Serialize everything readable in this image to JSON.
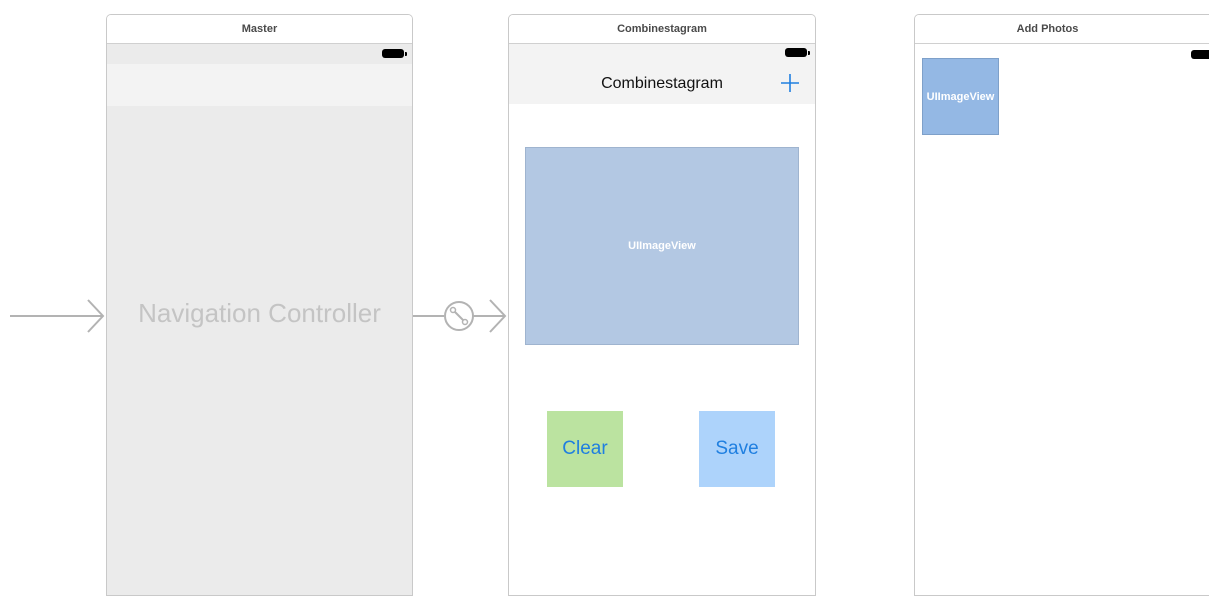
{
  "scenes": {
    "master": {
      "header": "Master",
      "body_label": "Navigation Controller"
    },
    "main": {
      "header": "Combinestagram",
      "nav_title": "Combinestagram",
      "image_view_label": "UIImageView",
      "clear_button": "Clear",
      "save_button": "Save"
    },
    "add_photos": {
      "header": "Add Photos",
      "thumb_label": "UIImageView"
    }
  },
  "colors": {
    "tint": "#1f7fe0",
    "clear_bg": "#bbe3a0",
    "save_bg": "#add3fb",
    "image_view_bg": "#b3c8e3",
    "thumb_bg": "#94b8e4"
  },
  "icons": {
    "entry_arrow": "entry-point-arrow-icon",
    "segue": "segue-relationship-icon",
    "add": "plus-icon",
    "battery": "battery-icon"
  }
}
